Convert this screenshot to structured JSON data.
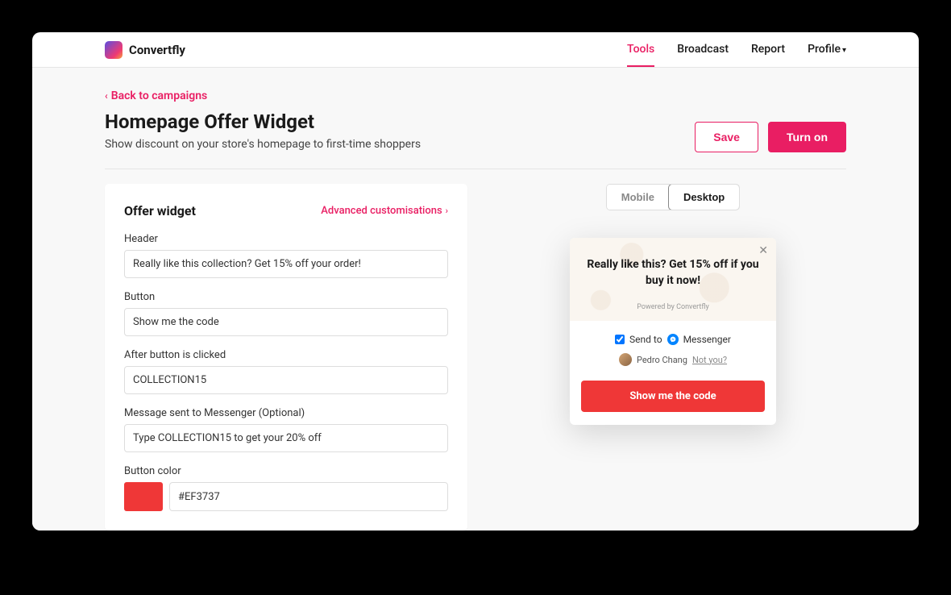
{
  "brand": {
    "name": "Convertfly"
  },
  "nav": {
    "items": [
      "Tools",
      "Broadcast",
      "Report",
      "Profile"
    ],
    "active": "Tools"
  },
  "backlink": "Back to campaigns",
  "page": {
    "title": "Homepage Offer Widget",
    "subtitle": "Show discount on your store's homepage to first-time shoppers"
  },
  "actions": {
    "save": "Save",
    "turnon": "Turn on"
  },
  "widget_card": {
    "title": "Offer widget",
    "advanced": "Advanced customisations",
    "fields": {
      "header_label": "Header",
      "header_value": "Really like this collection? Get 15% off your order!",
      "button_label": "Button",
      "button_value": "Show me the code",
      "after_label": "After button is clicked",
      "after_value": "COLLECTION15",
      "msg_label": "Message sent to Messenger (Optional)",
      "msg_value": "Type COLLECTION15 to get your 20% off",
      "color_label": "Button color",
      "color_value": "#EF3737"
    }
  },
  "device": {
    "mobile": "Mobile",
    "desktop": "Desktop",
    "active": "Desktop"
  },
  "preview": {
    "title": "Really like this? Get 15% off if you buy it now!",
    "powered": "Powered by Convertfly",
    "sendto_prefix": "Send to",
    "sendto_app": "Messenger",
    "user": "Pedro Chang",
    "notyou": "Not you?",
    "cta": "Show me the code"
  },
  "colors": {
    "accent": "#e91e63",
    "button": "#EF3737"
  }
}
